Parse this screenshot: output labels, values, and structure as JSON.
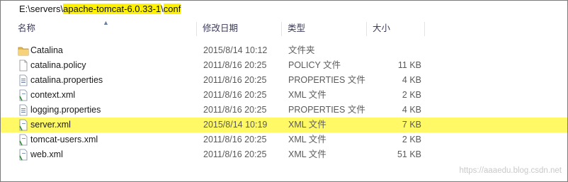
{
  "address": {
    "prefix": "E:\\servers\\",
    "highlight1": "apache-tomcat-6.0.33-1",
    "sep": "\\",
    "highlight2": "conf"
  },
  "columns": {
    "name": "名称",
    "date": "修改日期",
    "type": "类型",
    "size": "大小"
  },
  "rows": [
    {
      "name": "Catalina",
      "date": "2015/8/14 10:12",
      "type": "文件夹",
      "size": "",
      "icon": "folder-icon"
    },
    {
      "name": "catalina.policy",
      "date": "2011/8/16 20:25",
      "type": "POLICY 文件",
      "size": "11 KB",
      "icon": "file-icon"
    },
    {
      "name": "catalina.properties",
      "date": "2011/8/16 20:25",
      "type": "PROPERTIES 文件",
      "size": "4 KB",
      "icon": "properties-file-icon"
    },
    {
      "name": "context.xml",
      "date": "2011/8/16 20:25",
      "type": "XML 文件",
      "size": "2 KB",
      "icon": "xml-file-icon"
    },
    {
      "name": "logging.properties",
      "date": "2011/8/16 20:25",
      "type": "PROPERTIES 文件",
      "size": "4 KB",
      "icon": "properties-file-icon"
    },
    {
      "name": "server.xml",
      "date": "2015/8/14 10:19",
      "type": "XML 文件",
      "size": "7 KB",
      "icon": "xml-file-icon",
      "highlighted": true
    },
    {
      "name": "tomcat-users.xml",
      "date": "2011/8/16 20:25",
      "type": "XML 文件",
      "size": "2 KB",
      "icon": "xml-file-icon"
    },
    {
      "name": "web.xml",
      "date": "2011/8/16 20:25",
      "type": "XML 文件",
      "size": "51 KB",
      "icon": "xml-file-icon"
    }
  ],
  "watermark": "https://aaaedu.blog.csdn.net",
  "colors": {
    "highlight": "#fff200",
    "row_highlight": "#fff966",
    "folder": "#e8b84a"
  }
}
